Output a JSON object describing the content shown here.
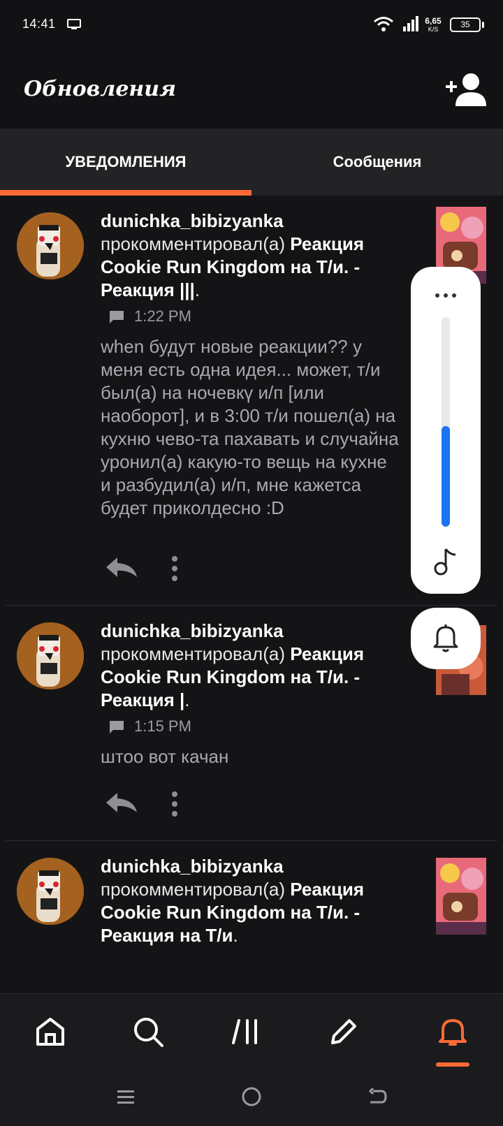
{
  "status_bar": {
    "time": "14:41",
    "net_speed_value": "6,65",
    "net_speed_unit": "K/S",
    "battery": "35"
  },
  "header": {
    "title": "Обновления"
  },
  "tabs": [
    {
      "label": "УВЕДОМЛЕНИЯ",
      "active": true
    },
    {
      "label": "Сообщения",
      "active": false
    }
  ],
  "notifications": [
    {
      "username": "dunichka_bibizyanka",
      "action": "прокомментировал(а)",
      "post_title": "Реакция Cookie Run Kingdom на Т/и. - Реакция |||",
      "time": "1:22 PM",
      "comment": "when будут новые реакции?? у меня есть одна идея... может, т/и был(а) на ночевкү и/п [или наоборот], и в 3:00 т/и пошел(а) на кухню чево-та пахавать и случайна уронил(а) какую-то вещь на кухне и разбудил(а) и/п, мне кажетса будет приколдесно :D"
    },
    {
      "username": "dunichka_bibizyanka",
      "action": "прокомментировал(а)",
      "post_title": "Реакция Cookie Run Kingdom на Т/и. - Реакция |",
      "time": "1:15 PM",
      "comment": "штоо вот качан"
    },
    {
      "username": "dunichka_bibizyanka",
      "action": "прокомментировал(а)",
      "post_title": "Реакция Cookie Run Kingdom на Т/и. - Реакция на Т/и",
      "time": "",
      "comment": ""
    }
  ],
  "volume": {
    "level": 0.48
  },
  "bottom_nav": {
    "items": [
      "home-icon",
      "search-icon",
      "library-icon",
      "pencil-icon",
      "bell-icon"
    ],
    "active": "bell-icon"
  },
  "colors": {
    "accent": "#ff6b35",
    "volume_fill": "#1a73f0",
    "background": "#141416"
  }
}
